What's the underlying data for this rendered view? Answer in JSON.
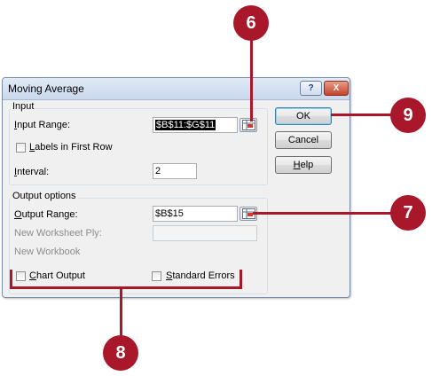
{
  "dialog": {
    "title": "Moving Average",
    "help_title_button": "?",
    "close_title_button": "X",
    "input_group": "Input",
    "input_range_label_prefix": "I",
    "input_range_label_rest": "nput Range:",
    "input_range_value": "$B$11:$G$11",
    "labels_first_row_prefix": "L",
    "labels_first_row_rest": "abels in First Row",
    "interval_label_prefix": "I",
    "interval_label_rest": "nterval:",
    "interval_value": "2",
    "output_group": "Output options",
    "output_range_label_prefix": "O",
    "output_range_label_rest": "utput Range:",
    "output_range_value": "$B$15",
    "new_worksheet_label": "New Worksheet Ply:",
    "new_workbook_label": "New Workbook",
    "chart_output_prefix": "C",
    "chart_output_rest": "hart Output",
    "standard_errors_prefix": "S",
    "standard_errors_rest": "tandard Errors",
    "ok_label": "OK",
    "cancel_label": "Cancel",
    "help_label_prefix": "H",
    "help_label_rest": "elp"
  },
  "callouts": {
    "c6": "6",
    "c7": "7",
    "c8": "8",
    "c9": "9"
  },
  "colors": {
    "callout": "#a9172b",
    "dialog_bg": "#f0f0f0"
  }
}
